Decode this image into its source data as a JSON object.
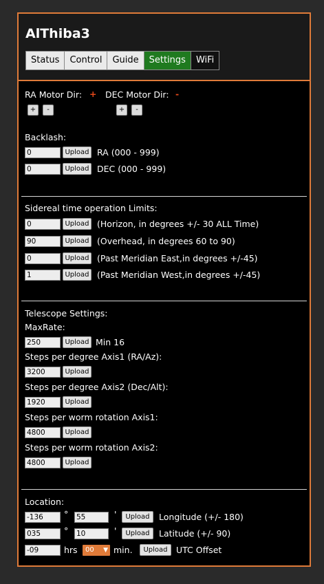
{
  "app": {
    "title": "AlThiba3"
  },
  "tabs": [
    {
      "label": "Status"
    },
    {
      "label": "Control"
    },
    {
      "label": "Guide"
    },
    {
      "label": "Settings"
    },
    {
      "label": "WiFi"
    }
  ],
  "motor": {
    "ra_label": "RA Motor Dir:",
    "ra_dir": "+",
    "dec_label": "DEC Motor Dir:",
    "dec_dir": "-",
    "plus": "+",
    "minus": "-"
  },
  "backlash": {
    "heading": "Backlash:",
    "ra": {
      "value": "0",
      "button": "Upload",
      "desc": "RA (000 - 999)"
    },
    "dec": {
      "value": "0",
      "button": "Upload",
      "desc": "DEC (000 - 999)"
    }
  },
  "limits": {
    "heading": "Sidereal time operation Limits:",
    "rows": [
      {
        "value": "0",
        "button": "Upload",
        "desc": "(Horizon, in degrees +/- 30 ALL Time)"
      },
      {
        "value": "90",
        "button": "Upload",
        "desc": "(Overhead, in degrees 60 to 90)"
      },
      {
        "value": "0",
        "button": "Upload",
        "desc": "(Past Meridian East,in degrees +/-45)"
      },
      {
        "value": "1",
        "button": "Upload",
        "desc": "(Past Meridian West,in degrees +/-45)"
      }
    ]
  },
  "telescope": {
    "heading": "Telescope Settings:",
    "maxrate": {
      "label": "MaxRate:",
      "value": "250",
      "button": "Upload",
      "desc": "Min 16"
    },
    "axis1": {
      "label": "Steps per degree Axis1 (RA/Az):",
      "value": "3200",
      "button": "Upload"
    },
    "axis2": {
      "label": "Steps per degree Axis2 (Dec/Alt):",
      "value": "1920",
      "button": "Upload"
    },
    "worm1": {
      "label": "Steps per worm rotation Axis1:",
      "value": "4800",
      "button": "Upload"
    },
    "worm2": {
      "label": "Steps per worm rotation Axis2:",
      "value": "4800",
      "button": "Upload"
    }
  },
  "location": {
    "heading": "Location:",
    "longitude": {
      "deg": "-136",
      "deg_sym": "°",
      "min": "55",
      "min_sym": "'",
      "button": "Upload",
      "desc": "Longitude (+/- 180)"
    },
    "latitude": {
      "deg": "035",
      "deg_sym": "°",
      "min": "10",
      "min_sym": "'",
      "button": "Upload",
      "desc": "Latitude (+/- 90)"
    },
    "utc": {
      "hrs": "-09",
      "hrs_label": "hrs",
      "min_value": "00",
      "min_label": "min.",
      "button": "Upload",
      "desc": "UTC Offset"
    }
  },
  "colors": {
    "accent": "#e07b39",
    "active_tab": "#1f7a1f",
    "dir_indicator": "#e84a1a"
  }
}
